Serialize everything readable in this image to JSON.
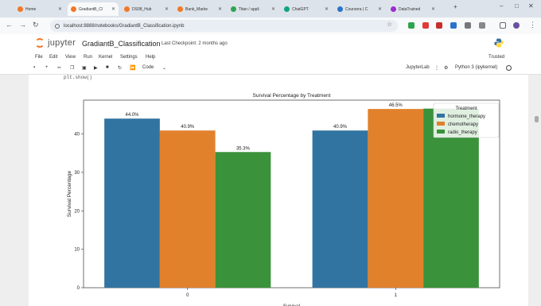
{
  "browser": {
    "tabs": [
      {
        "title": "Home",
        "color": "#f37726"
      },
      {
        "title": "GradiantB_Cl",
        "color": "#f37726"
      },
      {
        "title": "DS08_Hub",
        "color": "#f37726"
      },
      {
        "title": "Bank_Marke",
        "color": "#f37726"
      },
      {
        "title": "Titan / appli",
        "color": "#2ea44f"
      },
      {
        "title": "ChatGPT",
        "color": "#10a37f"
      },
      {
        "title": "Coursera | C",
        "color": "#2a73cc"
      },
      {
        "title": "DataTrained",
        "color": "#9b2ccf"
      }
    ],
    "url": "localhost:8888/notebooks/GradiantB_Classification.ipynb"
  },
  "jupyter": {
    "logo_text": "jupyter",
    "notebook_name": "GradiantB_Classification",
    "checkpoint": "Last Checkpoint: 2 months ago",
    "menu": [
      "File",
      "Edit",
      "View",
      "Run",
      "Kernel",
      "Settings",
      "Help"
    ],
    "trusted": "Trusted",
    "cell_type": "Code",
    "jupyterlab_label": "JupyterLab",
    "kernel": "Python 3 (ipykernel)"
  },
  "code_fragment": "plt.show()",
  "chart_data": {
    "type": "bar",
    "title": "Survival Percentage by Treatment",
    "xlabel": "Survival",
    "ylabel": "Survival Percentage",
    "categories": [
      "0",
      "1"
    ],
    "series": [
      {
        "name": "hormone_therapy",
        "color": "#3274a1",
        "values": [
          44.0,
          40.9
        ],
        "labels": [
          "44.0%",
          "40.9%"
        ]
      },
      {
        "name": "chemotherapy",
        "color": "#e1812c",
        "values": [
          40.9,
          46.5
        ],
        "labels": [
          "40.9%",
          "46.5%"
        ]
      },
      {
        "name": "radio_therapy",
        "color": "#3a923a",
        "values": [
          35.3,
          46.6
        ],
        "labels": [
          "35.3%",
          ""
        ]
      }
    ],
    "yticks": [
      0,
      10,
      20,
      30,
      40
    ],
    "ylim": [
      0,
      48.8
    ],
    "legend_title": "Treatment",
    "legend_position": "top-right",
    "grid": false
  }
}
